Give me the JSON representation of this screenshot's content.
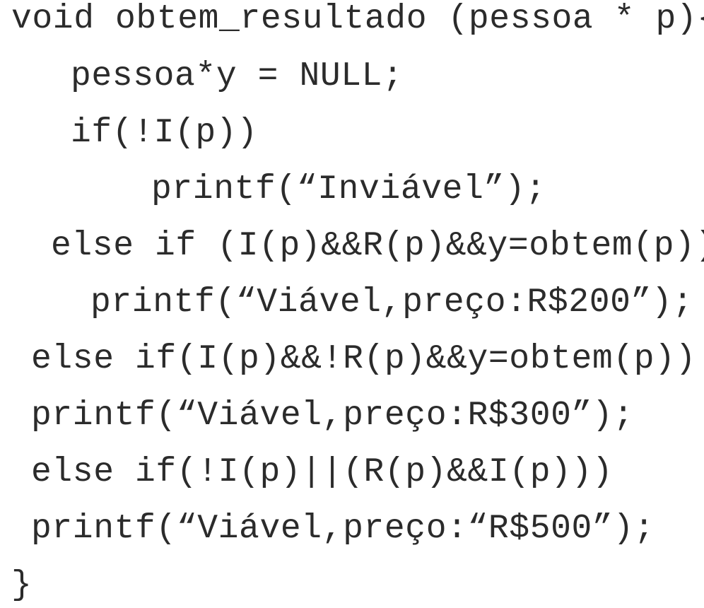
{
  "code": {
    "lines": [
      "void obtem_resultado (pessoa * p){",
      "pessoa*y = NULL;",
      "if(!I(p))",
      "printf(“Inviável”);",
      "else if (I(p)&&R(p)&&y=obtem(p))",
      "printf(“Viável,preço:R$200”);",
      "else if(I(p)&&!R(p)&&y=obtem(p))",
      "printf(“Viável,preço:R$300”);",
      "else if(!I(p)||(R(p)&&I(p)))",
      "printf(“Viável,preço:“R$500”);",
      "}"
    ]
  }
}
